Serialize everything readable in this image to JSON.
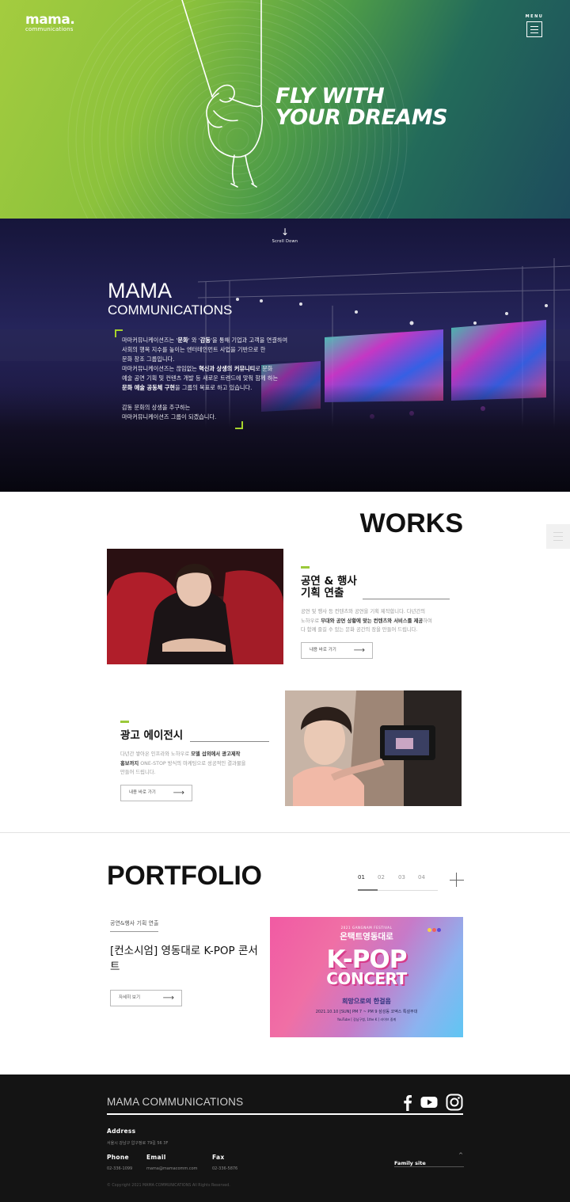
{
  "header": {
    "logo_main": "mama.",
    "logo_sub": "communications",
    "menu_label": "MENU"
  },
  "hero": {
    "title_line1": "FLY WITH",
    "title_line2": "YOUR DREAMS",
    "colors": {
      "left": "#a4cc3f",
      "right": "#1d4b5c"
    }
  },
  "about": {
    "scroll_label": "Scroll  Down",
    "title_line1": "MAMA",
    "title_line2": "COMMUNICATIONS",
    "p1_a": "마마커뮤니케이션즈는 '",
    "p1_b": "문화",
    "p1_c": "' 와 '",
    "p1_d": "감동",
    "p1_e": "'을 통해 기업과 고객을 연결하여",
    "p2": "사회의 행복 지수를 높이는 엔터테인먼트 사업을 기반으로 한",
    "p3": "문화 창조 그룹입니다.",
    "p4_a": "마마커뮤니케이션즈는 끊임없는 ",
    "p4_b": "혁신과 상생의 커뮤니티",
    "p4_c": "로 문화",
    "p5": "예술 공연 기획 및 컨텐츠 개발 등 새로운 트렌드에 맞춰 함께 하는",
    "p6_a": "문화 예술 공동체 구현",
    "p6_b": "을 그룹의 목표로 하고 있습니다.",
    "p7": "감동 문화의 상생을 추구하는",
    "p8": "마마커뮤니케이션즈 그룹이 되겠습니다.",
    "accent": "#a6d22d"
  },
  "works": {
    "title": "WORKS",
    "items": [
      {
        "title_line1": "공연 & 행사",
        "title_line2": "기획 연출",
        "desc_a": "공연 및 행사 등 컨텐츠와 공연을 기획 제작합니다. 다년간의",
        "desc_b": "노하우로 ",
        "desc_c": "무대와 공연 상황에 맞는 컨텐츠와 서비스를 제공",
        "desc_d": "하여",
        "desc_e": "다 함께 즐길 수 있는 문화 공간의 장을 만들어 드립니다.",
        "button": "내용 바로 가기"
      },
      {
        "title_line1": "광고 에이전시",
        "desc_a": "다년간 쌓아온 인프라와 노하우로 ",
        "desc_b": "모델 섭외에서 광고제작",
        "desc_c": "홍보까지",
        "desc_d": " ONE-STOP 방식의 마케팅으로 성공적인 결과물을",
        "desc_e": "만들어 드립니다.",
        "button": "내용 바로 가기"
      }
    ]
  },
  "portfolio": {
    "title": "PORTFOLIO",
    "pages": [
      "01",
      "02",
      "03",
      "04"
    ],
    "active_page": 0,
    "category": "공연&행사 기획 연출",
    "name": "[컨소시엄] 영동대로 K-POP 콘서트",
    "button": "자세히 보기",
    "poster": {
      "sub": "2021 GANGNAM FESTIVAL",
      "headline": "온택트영동대로",
      "kpop_line1": "K-POP",
      "kpop_line2": "CONCERT",
      "slogan": "희망으로의 한걸음",
      "date": "2021.10.10 [SUN] PM 7 ~ PM 9    삼성동 코엑스 특설무대",
      "youtube": "YouTube  [ 강남구청, 1the K ]  라이브 중계"
    }
  },
  "footer": {
    "brand": "MAMA COMMUNICATIONS",
    "address_label": "Address",
    "address": "서울시 강남구 압구정로 79길 56 3F",
    "phone_label": "Phone",
    "phone": "02-336-1099",
    "email_label": "Email",
    "email": "mama@mamacomm.com",
    "fax_label": "Fax",
    "fax": "02-336-5876",
    "family_site": "Family site",
    "copyright": "© Copyright 2021 MAMA COMMUNICATIONS All Rights Reserved."
  }
}
